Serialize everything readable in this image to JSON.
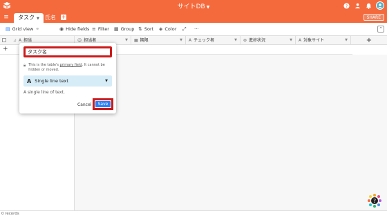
{
  "topbar": {
    "base_title": "サイトDB",
    "brand_color": "#f46a3c"
  },
  "tabs": {
    "active": "タスク",
    "items": [
      "氏名"
    ],
    "share_label": "SHARE"
  },
  "toolbar": {
    "view_name": "Grid view",
    "hide_fields": "Hide fields",
    "filter": "Filter",
    "group": "Group",
    "sort": "Sort",
    "color": "Color"
  },
  "columns": [
    {
      "label": "担当",
      "icon": "text-icon"
    },
    {
      "label": "担当者",
      "icon": "person-icon"
    },
    {
      "label": "期限",
      "icon": "calendar-icon"
    },
    {
      "label": "チェック者",
      "icon": "text-icon"
    },
    {
      "label": "進捗状況",
      "icon": "status-icon"
    },
    {
      "label": "対象サイト",
      "icon": "text-icon"
    }
  ],
  "footer": {
    "records": "0 records"
  },
  "popup": {
    "field_name_value": "タスク名",
    "note_before": "This is the table's ",
    "note_link": "primary field",
    "note_after": ". It cannot be hidden or moved.",
    "type_label": "Single line text",
    "type_description": "A single line of text.",
    "cancel_label": "Cancel",
    "save_label": "Save",
    "highlight_color": "#cc1a1a",
    "save_color": "#2d7ff9"
  }
}
